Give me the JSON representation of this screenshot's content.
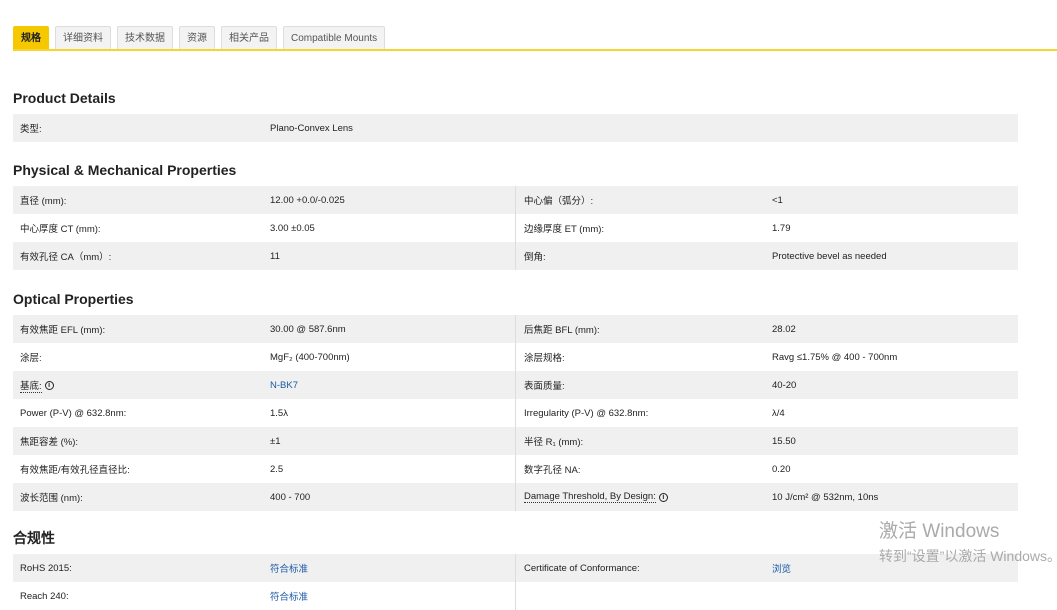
{
  "tabs": [
    "规格",
    "详细资料",
    "技术数据",
    "资源",
    "相关产品",
    "Compatible Mounts"
  ],
  "product_details": {
    "title": "Product Details",
    "rows": [
      {
        "label": "类型:",
        "value": "Plano-Convex Lens"
      }
    ]
  },
  "physical": {
    "title": "Physical & Mechanical Properties",
    "rows": [
      {
        "l1": "直径 (mm):",
        "v1": "12.00 +0.0/-0.025",
        "l2": "中心偏（弧分）:",
        "v2": "<1"
      },
      {
        "l1": "中心厚度 CT (mm):",
        "v1": "3.00 ±0.05",
        "l2": "边缘厚度 ET (mm):",
        "v2": "1.79"
      },
      {
        "l1": "有效孔径 CA（mm）:",
        "v1": "11",
        "l2": "倒角:",
        "v2": "Protective bevel as needed"
      }
    ]
  },
  "optical": {
    "title": "Optical Properties",
    "rows": [
      {
        "l1": "有效焦距 EFL (mm):",
        "v1": "30.00 @ 587.6nm",
        "l2": "后焦距 BFL (mm):",
        "v2": "28.02"
      },
      {
        "l1": "涂层:",
        "v1": "MgF₂ (400-700nm)",
        "l2": "涂层规格:",
        "v2": "Ravg ≤1.75% @ 400 - 700nm"
      },
      {
        "l1": "基底:",
        "v1": "N-BK7",
        "l2": "表面质量:",
        "v2": "40-20"
      },
      {
        "l1": "Power (P-V) @ 632.8nm:",
        "v1": "1.5λ",
        "l2": "Irregularity (P-V) @ 632.8nm:",
        "v2": "λ/4"
      },
      {
        "l1": "焦距容差 (%):",
        "v1": "±1",
        "l2": "半径 R₁ (mm):",
        "v2": "15.50"
      },
      {
        "l1": "有效焦距/有效孔径直径比:",
        "v1": "2.5",
        "l2": "数字孔径 NA:",
        "v2": "0.20"
      },
      {
        "l1": "波长范围 (nm):",
        "v1": "400 - 700",
        "l2": "Damage Threshold, By Design:",
        "v2": "10 J/cm² @ 532nm, 10ns"
      }
    ]
  },
  "compliance": {
    "title": "合规性",
    "rows": [
      {
        "l1": "RoHS 2015:",
        "v1": "符合标准",
        "l2": "Certificate of Conformance:",
        "v2": "浏览"
      },
      {
        "l1": "Reach 240:",
        "v1": "符合标准"
      }
    ]
  },
  "watermark": {
    "line1": "激活 Windows",
    "line2": "转到“设置”以激活 Windows。"
  }
}
